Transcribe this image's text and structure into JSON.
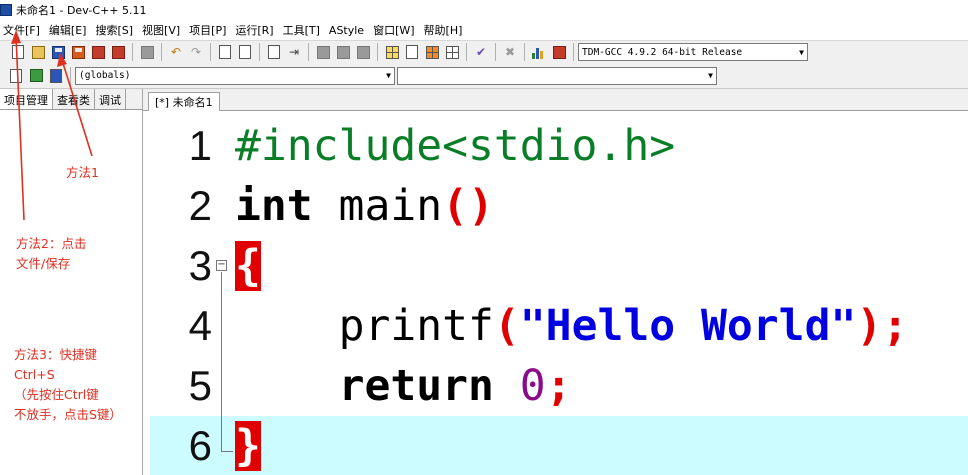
{
  "window": {
    "title": "未命名1 - Dev-C++ 5.11"
  },
  "menu": [
    "文件[F]",
    "编辑[E]",
    "搜索[S]",
    "视图[V]",
    "项目[P]",
    "运行[R]",
    "工具[T]",
    "AStyle",
    "窗口[W]",
    "帮助[H]"
  ],
  "toolbar": {
    "compiler_select": "TDM-GCC 4.9.2 64-bit Release",
    "globals_select": "(globals)",
    "members_select": ""
  },
  "left_panel": {
    "tabs": [
      "项目管理",
      "查看类",
      "调试"
    ]
  },
  "editor": {
    "tab_label": "[*] 未命名1",
    "line_numbers": [
      "1",
      "2",
      "3",
      "4",
      "5",
      "6"
    ],
    "code_tokens": {
      "l1_include": "#include<stdio.h>",
      "l2_type": "int",
      "l2_name": " main",
      "l2_parens": "()",
      "l3_brace": "{",
      "l4_indent": "    ",
      "l4_func": "printf",
      "l4_lparen": "(",
      "l4_string": "\"Hello World\"",
      "l4_end": ");",
      "l5_indent": "    ",
      "l5_keyword": "return",
      "l5_space": " ",
      "l5_num": "0",
      "l5_semi": ";",
      "l6_brace": "}"
    },
    "active_line": 6,
    "colors": {
      "preprocessor": "#0a7d27",
      "symbol": "#e00000",
      "string": "#0000e0",
      "number": "#8b0a8b",
      "active_line": "#ccfcff"
    }
  },
  "annotations": {
    "method1": "方法1",
    "method2_line1": "方法2：点击",
    "method2_line2": "文件/保存",
    "method3_line1": "方法3：快捷键",
    "method3_line2": "Ctrl+S",
    "method3_line3": "（先按住Ctrl键",
    "method3_line4": "不放手，点击S键）"
  }
}
